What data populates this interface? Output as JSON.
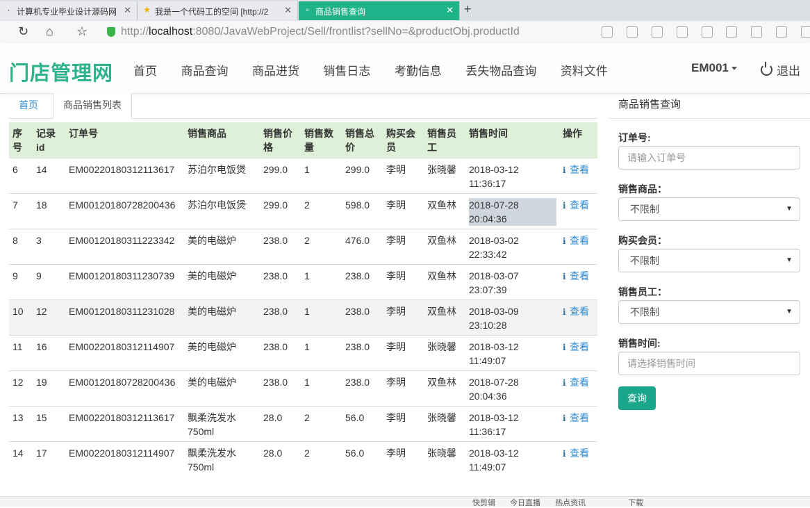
{
  "browser": {
    "tabs": [
      {
        "title": "计算机专业毕业设计源码网",
        "active": false
      },
      {
        "title": "我是一个代码工的空间 [http://2",
        "active": false
      },
      {
        "title": "商品销售查询",
        "active": true
      }
    ],
    "new_tab": "+",
    "url_scheme": "http://",
    "url_host": "localhost",
    "url_rest": ":8080/JavaWebProject/Sell/frontlist?sellNo=&productObj.productId"
  },
  "navbar": {
    "brand": "门店管理网",
    "menu": [
      "首页",
      "商品查询",
      "商品进货",
      "销售日志",
      "考勤信息",
      "丢失物品查询",
      "资料文件"
    ],
    "user": "EM001",
    "logout": "退出"
  },
  "breadcrumb": {
    "home": "首页",
    "current": "商品销售列表"
  },
  "table": {
    "headers": [
      [
        "序",
        "号"
      ],
      [
        "记录",
        "id"
      ],
      [
        "订单号",
        ""
      ],
      [
        "销售商品",
        ""
      ],
      [
        "销售价",
        "格"
      ],
      [
        "销售数",
        "量"
      ],
      [
        "销售总",
        "价"
      ],
      [
        "购买会",
        "员"
      ],
      [
        "销售员",
        "工"
      ],
      [
        "销售时间",
        ""
      ],
      [
        "操作",
        ""
      ]
    ],
    "view_label": "查看",
    "rows": [
      {
        "no": "6",
        "id": "14",
        "order": "EM00220180312113617",
        "product": [
          "苏泊尔电饭煲",
          ""
        ],
        "price": "299.0",
        "qty": "1",
        "total": "299.0",
        "member": "李明",
        "staff": "张晓馨",
        "date": "2018-03-12",
        "time": "11:36:17"
      },
      {
        "no": "7",
        "id": "18",
        "order": "EM00120180728200436",
        "product": [
          "苏泊尔电饭煲",
          ""
        ],
        "price": "299.0",
        "qty": "2",
        "total": "598.0",
        "member": "李明",
        "staff": "双鱼林",
        "date": "2018-07-28",
        "time": "20:04:36"
      },
      {
        "no": "8",
        "id": "3",
        "order": "EM00120180311223342",
        "product": [
          "美的电磁炉",
          ""
        ],
        "price": "238.0",
        "qty": "2",
        "total": "476.0",
        "member": "李明",
        "staff": "双鱼林",
        "date": "2018-03-02",
        "time": "22:33:42"
      },
      {
        "no": "9",
        "id": "9",
        "order": "EM00120180311230739",
        "product": [
          "美的电磁炉",
          ""
        ],
        "price": "238.0",
        "qty": "1",
        "total": "238.0",
        "member": "李明",
        "staff": "双鱼林",
        "date": "2018-03-07",
        "time": "23:07:39"
      },
      {
        "no": "10",
        "id": "12",
        "order": "EM00120180311231028",
        "product": [
          "美的电磁炉",
          ""
        ],
        "price": "238.0",
        "qty": "1",
        "total": "238.0",
        "member": "李明",
        "staff": "双鱼林",
        "date": "2018-03-09",
        "time": "23:10:28"
      },
      {
        "no": "11",
        "id": "16",
        "order": "EM00220180312114907",
        "product": [
          "美的电磁炉",
          ""
        ],
        "price": "238.0",
        "qty": "1",
        "total": "238.0",
        "member": "李明",
        "staff": "张晓馨",
        "date": "2018-03-12",
        "time": "11:49:07"
      },
      {
        "no": "12",
        "id": "19",
        "order": "EM00120180728200436",
        "product": [
          "美的电磁炉",
          ""
        ],
        "price": "238.0",
        "qty": "1",
        "total": "238.0",
        "member": "李明",
        "staff": "双鱼林",
        "date": "2018-07-28",
        "time": "20:04:36"
      },
      {
        "no": "13",
        "id": "15",
        "order": "EM00220180312113617",
        "product": [
          "飘柔洗发水",
          "750ml"
        ],
        "price": "28.0",
        "qty": "2",
        "total": "56.0",
        "member": "李明",
        "staff": "张晓馨",
        "date": "2018-03-12",
        "time": "11:36:17"
      },
      {
        "no": "14",
        "id": "17",
        "order": "EM00220180312114907",
        "product": [
          "飘柔洗发水",
          "750ml"
        ],
        "price": "28.0",
        "qty": "2",
        "total": "56.0",
        "member": "李明",
        "staff": "张晓馨",
        "date": "2018-03-12",
        "time": "11:49:07"
      }
    ]
  },
  "search": {
    "title": "商品销售查询",
    "order_label": "订单号:",
    "order_placeholder": "请输入订单号",
    "product_label": "销售商品：",
    "product_value": "不限制",
    "member_label": "购买会员：",
    "member_value": "不限制",
    "staff_label": "销售员工：",
    "staff_value": "不限制",
    "time_label": "销售时间:",
    "time_placeholder": "请选择销售时间",
    "submit": "查询"
  },
  "statusbar": [
    "快剪辑",
    "今日直播",
    "热点资讯",
    "下载"
  ]
}
